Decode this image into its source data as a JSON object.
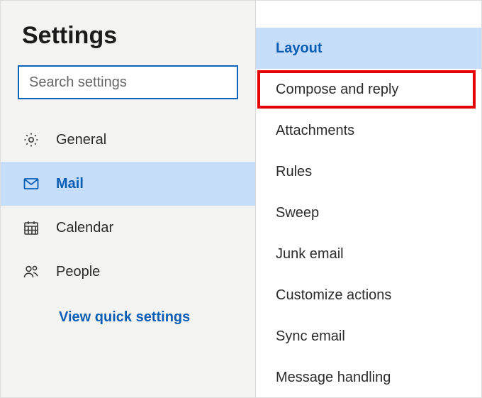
{
  "title": "Settings",
  "search": {
    "placeholder": "Search settings"
  },
  "nav": {
    "items": [
      {
        "label": "General",
        "icon": "gear-icon"
      },
      {
        "label": "Mail",
        "icon": "mail-icon"
      },
      {
        "label": "Calendar",
        "icon": "calendar-icon"
      },
      {
        "label": "People",
        "icon": "people-icon"
      }
    ]
  },
  "quickLink": "View quick settings",
  "options": [
    {
      "label": "Layout"
    },
    {
      "label": "Compose and reply"
    },
    {
      "label": "Attachments"
    },
    {
      "label": "Rules"
    },
    {
      "label": "Sweep"
    },
    {
      "label": "Junk email"
    },
    {
      "label": "Customize actions"
    },
    {
      "label": "Sync email"
    },
    {
      "label": "Message handling"
    }
  ]
}
